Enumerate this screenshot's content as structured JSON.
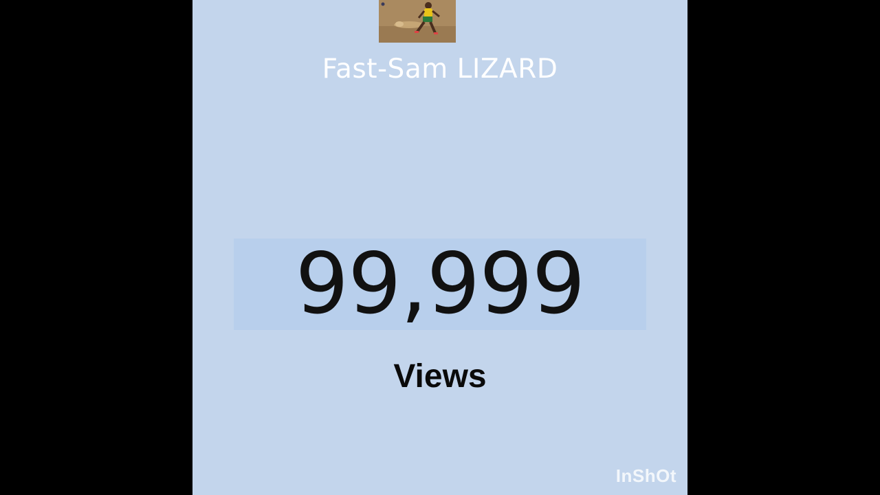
{
  "video": {
    "channel_name": "Fast-Sam LIZARD",
    "counter_value": "99,999",
    "counter_label": "Views",
    "watermark": "InShOt"
  },
  "colors": {
    "background_panel": "#c3d5ec",
    "counter_highlight": "#b8cfec",
    "letterbox": "#000000",
    "title_text": "#ffffff",
    "counter_text": "#111111"
  },
  "icons": {
    "thumbnail": "runner-thumbnail-image"
  }
}
